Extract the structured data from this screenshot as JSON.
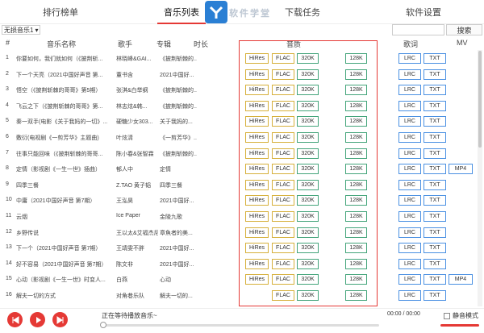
{
  "tabs": [
    {
      "label": "排行榜单"
    },
    {
      "label": "音乐列表"
    },
    {
      "label": "下载任务"
    },
    {
      "label": "软件设置"
    }
  ],
  "logo_text": "软件学堂",
  "toolbar": {
    "source": "无损音乐1",
    "search_label": "搜索",
    "search_value": ""
  },
  "headers": {
    "num": "#",
    "name": "音乐名称",
    "singer": "歌手",
    "album": "专辑",
    "duration": "时长",
    "quality": "音质",
    "lyrics": "歌词",
    "mv": "MV"
  },
  "badges": {
    "hires": "HiRes",
    "flac": "FLAC",
    "k320": "320K",
    "k128": "128K",
    "lrc": "LRC",
    "txt": "TXT",
    "mp4": "MP4"
  },
  "rows": [
    {
      "num": "1",
      "name": "你要如何，我们就如何（《披荆斩...",
      "singer": "林晓峰&GAI...",
      "album": "《披荆斩棘的...",
      "hires": true,
      "flac": true,
      "k320": true,
      "k128": true,
      "lrc": true,
      "txt": true,
      "mp4": false
    },
    {
      "num": "2",
      "name": "下一个天亮（2021中国好声音 第...",
      "singer": "董书含",
      "album": "2021中国好...",
      "hires": true,
      "flac": true,
      "k320": true,
      "k128": true,
      "lrc": true,
      "txt": true,
      "mp4": false
    },
    {
      "num": "3",
      "name": "悟空（《披荆斩棘的哥哥》第5期）",
      "singer": "张淇&白举纲",
      "album": "《披荆斩棘的...",
      "hires": true,
      "flac": true,
      "k320": true,
      "k128": true,
      "lrc": true,
      "txt": true,
      "mp4": false
    },
    {
      "num": "4",
      "name": "飞云之下（《披荆斩棘的哥哥》第...",
      "singer": "林志炫&韩...",
      "album": "《披荆斩棘的...",
      "hires": true,
      "flac": true,
      "k320": true,
      "k128": true,
      "lrc": true,
      "txt": true,
      "mp4": false
    },
    {
      "num": "5",
      "name": "秦一双手(电影《关于我妈的一切》...",
      "singer": "硬糖少女303...",
      "album": "关于我妈的...",
      "hires": true,
      "flac": true,
      "k320": true,
      "k128": true,
      "lrc": true,
      "txt": true,
      "mp4": false
    },
    {
      "num": "6",
      "name": "敷衍(电视剧《一剪芳华》主题曲)",
      "singer": "叶炫清",
      "album": "《一剪芳华》...",
      "hires": true,
      "flac": true,
      "k320": true,
      "k128": true,
      "lrc": true,
      "txt": true,
      "mp4": false
    },
    {
      "num": "7",
      "name": "往事只能回味（《披荆斩棘的哥哥...",
      "singer": "陈小春&张智霖",
      "album": "《披荆斩棘的...",
      "hires": true,
      "flac": true,
      "k320": true,
      "k128": true,
      "lrc": true,
      "txt": true,
      "mp4": false
    },
    {
      "num": "8",
      "name": "定情（影视剧《一生一世》插曲）",
      "singer": "郁人中",
      "album": "定情",
      "hires": true,
      "flac": true,
      "k320": true,
      "k128": true,
      "lrc": true,
      "txt": true,
      "mp4": true
    },
    {
      "num": "9",
      "name": "四季三餐",
      "singer": "Z.TAO 黄子韬",
      "album": "四季三餐",
      "hires": true,
      "flac": true,
      "k320": true,
      "k128": true,
      "lrc": true,
      "txt": true,
      "mp4": false
    },
    {
      "num": "10",
      "name": "中庸（2021中国好声音 第7期）",
      "singer": "王泓昊",
      "album": "2021中国好...",
      "hires": true,
      "flac": true,
      "k320": true,
      "k128": true,
      "lrc": true,
      "txt": true,
      "mp4": false
    },
    {
      "num": "11",
      "name": "云烟",
      "singer": "Ice Paper",
      "album": "金陵九歌",
      "hires": true,
      "flac": true,
      "k320": true,
      "k128": true,
      "lrc": true,
      "txt": true,
      "mp4": false
    },
    {
      "num": "12",
      "name": "乡野传说",
      "singer": "王以太&艾福杰尼",
      "album": "章魚者的美...",
      "hires": true,
      "flac": true,
      "k320": true,
      "k128": true,
      "lrc": true,
      "txt": true,
      "mp4": false
    },
    {
      "num": "13",
      "name": "下一个（2021中国好声音 第7期）",
      "singer": "王靖雯不胖",
      "album": "2021中国好...",
      "hires": true,
      "flac": true,
      "k320": true,
      "k128": true,
      "lrc": true,
      "txt": true,
      "mp4": false
    },
    {
      "num": "14",
      "name": "好不容易（2021中国好声音 第7期）",
      "singer": "陈文非",
      "album": "2021中国好...",
      "hires": true,
      "flac": true,
      "k320": true,
      "k128": true,
      "lrc": true,
      "txt": true,
      "mp4": false
    },
    {
      "num": "15",
      "name": "心动（影视剧《一生一世》时变人...",
      "singer": "白燕",
      "album": "心动",
      "hires": true,
      "flac": true,
      "k320": true,
      "k128": true,
      "lrc": true,
      "txt": true,
      "mp4": true
    },
    {
      "num": "16",
      "name": "解夫一切的方式",
      "singer": "对角巷乐队",
      "album": "解夫一切的...",
      "hires": false,
      "flac": true,
      "k320": true,
      "k128": true,
      "lrc": true,
      "txt": true,
      "mp4": false
    }
  ],
  "player": {
    "status": "正在等待播放音乐~",
    "time": "00:00 / 00:00",
    "mute_label": "静音模式",
    "progress": 0.0,
    "volume": 1.0
  },
  "colors": {
    "accent": "#e53935",
    "lrc_border": "#4a90e2",
    "hires_border": "#d6b03b",
    "k128_border": "#43a47a"
  }
}
